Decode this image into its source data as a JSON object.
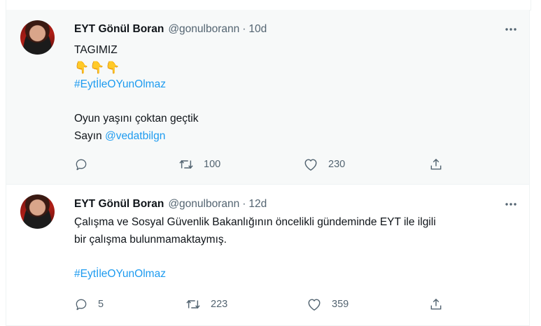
{
  "tweets": [
    {
      "name": "EYT Gönül Boran",
      "handle": "@gonulborann",
      "separator": "·",
      "time": "10d",
      "lines": [
        {
          "parts": [
            {
              "text": "TAGIMIZ",
              "link": false
            }
          ]
        },
        {
          "emoji": "👇👇👇"
        },
        {
          "parts": [
            {
              "text": "#EytİleOYunOlmaz",
              "link": true
            }
          ]
        },
        {
          "parts": [
            {
              "text": "",
              "link": false
            }
          ]
        },
        {
          "parts": [
            {
              "text": "Oyun yaşını çoktan geçtik",
              "link": false
            }
          ]
        },
        {
          "parts": [
            {
              "text": "Sayın ",
              "link": false
            },
            {
              "text": "@vedatbilgn",
              "link": true
            }
          ]
        }
      ],
      "actions": {
        "reply": "",
        "retweet": "100",
        "like": "230"
      }
    },
    {
      "name": "EYT Gönül Boran",
      "handle": "@gonulborann",
      "separator": "·",
      "time": "12d",
      "lines": [
        {
          "parts": [
            {
              "text": "Çalışma ve Sosyal Güvenlik Bakanlığının öncelikli gündeminde EYT ile ilgili",
              "link": false
            }
          ]
        },
        {
          "parts": [
            {
              "text": "bir çalışma bulunmamaktaymış.",
              "link": false
            }
          ]
        },
        {
          "parts": [
            {
              "text": "",
              "link": false
            }
          ]
        },
        {
          "parts": [
            {
              "text": "#EytİleOYunOlmaz",
              "link": true
            }
          ]
        }
      ],
      "actions": {
        "reply": "5",
        "retweet": "223",
        "like": "359"
      }
    }
  ],
  "icons": {
    "more": "more-dots-icon",
    "reply": "reply-icon",
    "retweet": "retweet-icon",
    "like": "heart-icon",
    "share": "share-icon"
  },
  "colors": {
    "link": "#1d9bf0",
    "secondary_text": "#536471",
    "primary_text": "#0f1419",
    "hover_bg": "#f7f9f9",
    "border": "#eff3f4"
  }
}
